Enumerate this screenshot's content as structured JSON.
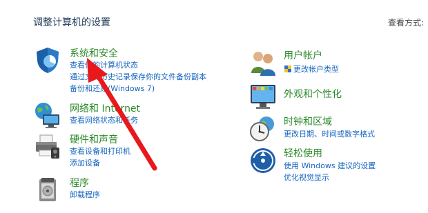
{
  "header": {
    "title": "调整计算机的设置",
    "view_by_label": "查看方式:"
  },
  "left_categories": [
    {
      "title": "系统和安全",
      "icon": "shield-icon",
      "links": [
        "查看你的计算机状态",
        "通过文件历史记录保存你的文件备份副本",
        "备份和还原(Windows 7)"
      ]
    },
    {
      "title": "网络和 Internet",
      "icon": "network-globe-icon",
      "links": [
        "查看网络状态和任务"
      ]
    },
    {
      "title": "硬件和声音",
      "icon": "printer-icon",
      "links": [
        "查看设备和打印机",
        "添加设备"
      ]
    },
    {
      "title": "程序",
      "icon": "programs-icon",
      "links": [
        "卸载程序"
      ]
    }
  ],
  "right_categories": [
    {
      "title": "用户帐户",
      "icon": "users-icon",
      "links": [
        "更改帐户类型"
      ]
    },
    {
      "title": "外观和个性化",
      "icon": "monitor-icon",
      "links": []
    },
    {
      "title": "时钟和区域",
      "icon": "clock-globe-icon",
      "links": [
        "更改日期、时间或数字格式"
      ]
    },
    {
      "title": "轻松使用",
      "icon": "ease-of-access-icon",
      "links": [
        "使用 Windows 建议的设置",
        "优化视觉显示"
      ]
    }
  ],
  "colors": {
    "category_title": "#2b8a2b",
    "link": "#1565c0",
    "arrow": "#e8191c"
  }
}
